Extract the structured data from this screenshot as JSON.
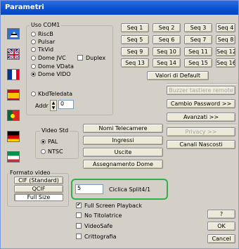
{
  "window": {
    "title": "Parametri"
  },
  "uso": {
    "legend": "Uso COM1",
    "options": [
      "RiscB",
      "Pulsar",
      "TkVid",
      "Dome JVC",
      "Dome VData",
      "Dome VIDO",
      "KbdTeledata"
    ],
    "selected": "Dome VIDO",
    "duplex_label": "Duplex",
    "addr_label": "Addr",
    "addr_value": "0"
  },
  "seq_buttons": [
    "Seq 1",
    "Seq 2",
    "Seq 3",
    "Seq 4",
    "Seq 5",
    "Seq 6",
    "Seq 7",
    "Seq 8",
    "Seq 9",
    "Seq 10",
    "Seq 11",
    "Seq 12",
    "Seq 13",
    "Seq 14",
    "Seq 15",
    "Seq 16"
  ],
  "buttons": {
    "default": "Valori di Default",
    "buzzer": "Buzzer tastiere remote",
    "password": "Cambio Password >>",
    "advanced": "Avanzati >>",
    "privacy": "Privacy >>",
    "hidden_channels": "Canali Nascosti",
    "camera_names": "Nomi Telecamere",
    "inputs": "Ingressi",
    "outputs": "Uscite",
    "dome_assign": "Assegnamento Dome",
    "help": "?",
    "ok": "OK",
    "cancel": "Cancel"
  },
  "video_std": {
    "legend": "Video Std",
    "options": [
      "PAL",
      "NTSC"
    ],
    "selected": "PAL"
  },
  "formato": {
    "legend": "Formato video",
    "options": [
      "CIF (Standard)",
      "QCIF",
      "Full Size"
    ]
  },
  "ciclica": {
    "value": "5",
    "label": "Ciclica Split4/1"
  },
  "checks": [
    {
      "label": "Full Screen Playback",
      "checked": true
    },
    {
      "label": "No Titolatrice",
      "checked": false
    },
    {
      "label": "VideoSafe",
      "checked": false
    },
    {
      "label": "Crittografia",
      "checked": false
    }
  ]
}
